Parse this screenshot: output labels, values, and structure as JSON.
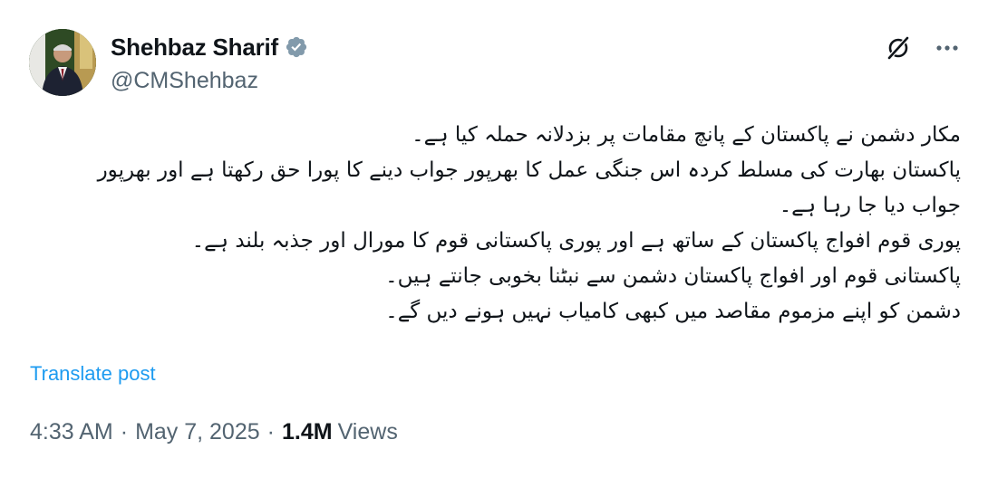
{
  "author": {
    "display_name": "Shehbaz Sharif",
    "handle": "@CMShehbaz",
    "verified": true,
    "verified_color": "#829aab"
  },
  "header_actions": {
    "grok_icon": "grok-icon",
    "more_icon": "more-icon"
  },
  "post": {
    "lines": [
      "مکار دشمن نے پاکستان کے پانچ مقامات پر بزدلانہ حملہ کیا ہے۔",
      "پاکستان بھارت کی مسلط کردہ اس جنگی عمل کا بھرپور جواب دینے کا پورا حق رکھتا ہے اور بھرپور",
      "جواب دیا جا رہا ہے۔",
      "پوری قوم افواج پاکستان کے ساتھ ہے اور پوری پاکستانی قوم کا مورال اور جذبہ بلند ہے۔",
      "پاکستانی قوم اور افواج پاکستان دشمن سے نبٹنا بخوبی جانتے ہیں۔",
      "دشمن کو اپنے مزموم مقاصد میں کبھی کامیاب نہیں ہونے دیں گے۔"
    ],
    "translate_label": "Translate post"
  },
  "meta": {
    "time": "4:33 AM",
    "separator": "·",
    "date": "May 7, 2025",
    "views_count": "1.4M",
    "views_label": "Views"
  },
  "colors": {
    "text": "#0f1419",
    "secondary": "#536471",
    "link": "#1d9bf0"
  }
}
